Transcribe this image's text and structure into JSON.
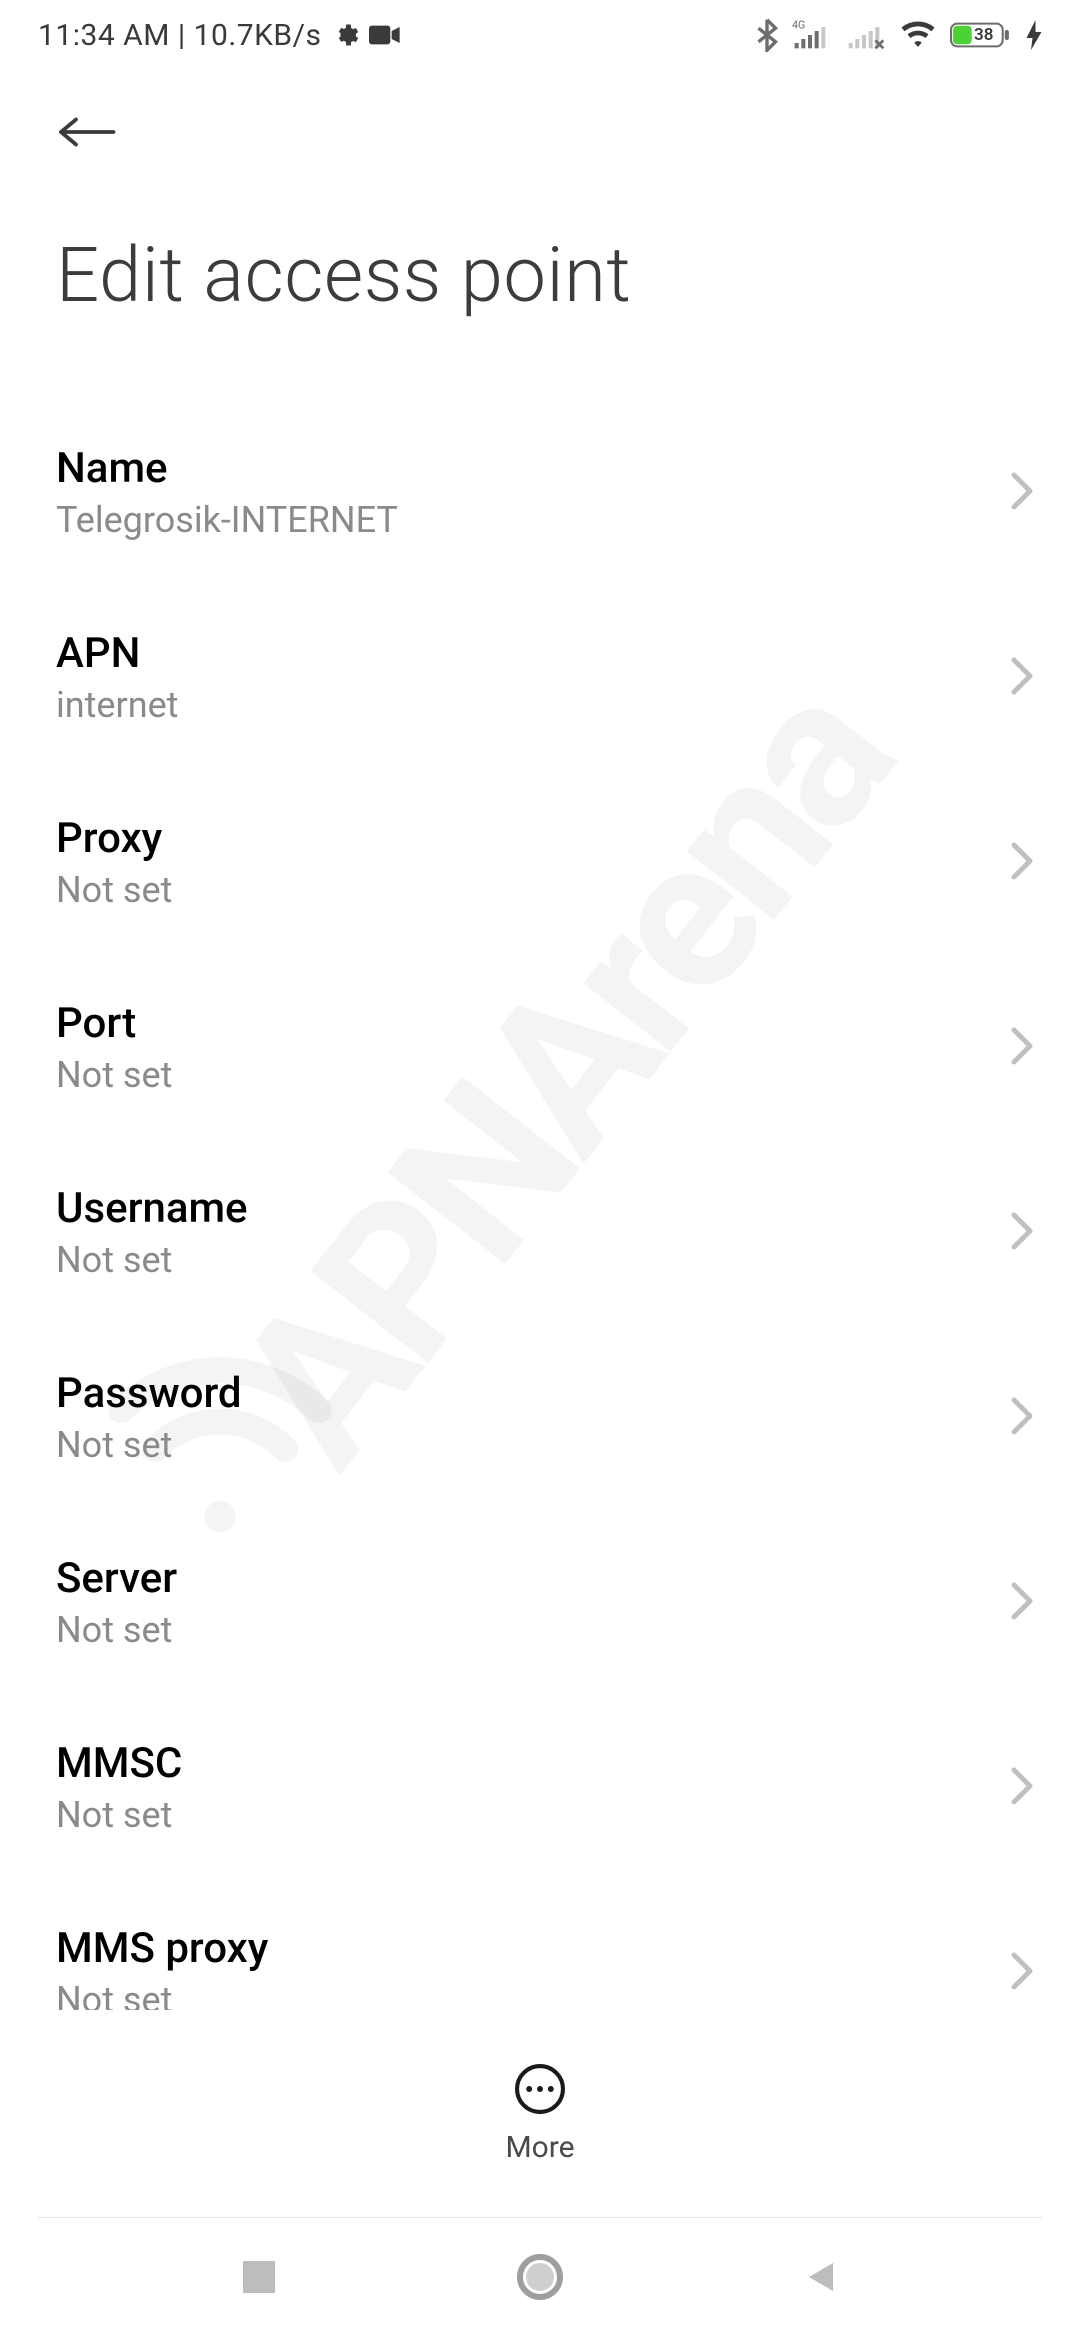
{
  "status": {
    "left_text": "11:34 AM | 10.7KB/s",
    "battery_percent": "38"
  },
  "header": {
    "title": "Edit access point"
  },
  "settings": [
    {
      "label": "Name",
      "value": "Telegrosik-INTERNET"
    },
    {
      "label": "APN",
      "value": "internet"
    },
    {
      "label": "Proxy",
      "value": "Not set"
    },
    {
      "label": "Port",
      "value": "Not set"
    },
    {
      "label": "Username",
      "value": "Not set"
    },
    {
      "label": "Password",
      "value": "Not set"
    },
    {
      "label": "Server",
      "value": "Not set"
    },
    {
      "label": "MMSC",
      "value": "Not set"
    },
    {
      "label": "MMS proxy",
      "value": "Not set"
    }
  ],
  "footer": {
    "more_label": "More"
  },
  "watermark": "APNArena"
}
